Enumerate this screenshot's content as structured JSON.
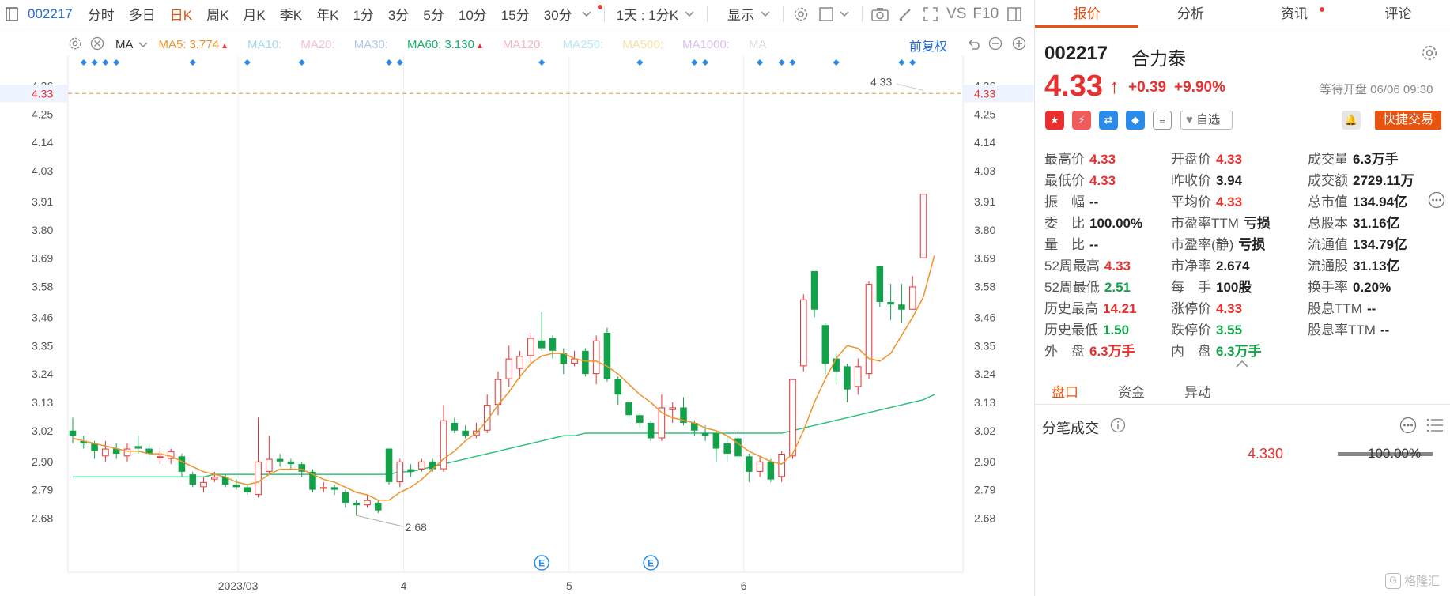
{
  "toolbar": {
    "code": "002217",
    "periods": [
      "分时",
      "多日",
      "日K",
      "周K",
      "月K",
      "季K",
      "年K",
      "1分",
      "3分",
      "5分",
      "10分",
      "15分",
      "30分"
    ],
    "active_period": "日K",
    "range": "1天 : 1分K",
    "display": "显示",
    "vs": "VS",
    "f10": "F10"
  },
  "ma_legend": {
    "type": "MA",
    "items": [
      {
        "label": "MA5:",
        "value": "3.774",
        "color": "#f0932b",
        "arrow": "▲"
      },
      {
        "label": "MA10:",
        "value": "",
        "color": "#a8d8f0"
      },
      {
        "label": "MA20:",
        "value": "",
        "color": "#f4c0d8"
      },
      {
        "label": "MA30:",
        "value": "",
        "color": "#b0c8f0"
      },
      {
        "label": "MA60:",
        "value": "3.130",
        "color": "#17b36b",
        "arrow": "▲"
      },
      {
        "label": "MA120:",
        "value": "",
        "color": "#f5b8c0"
      },
      {
        "label": "MA250:",
        "value": "",
        "color": "#b8e8f4"
      },
      {
        "label": "MA500:",
        "value": "",
        "color": "#f6e0a8"
      },
      {
        "label": "MA1000:",
        "value": "",
        "color": "#d8c0f0"
      },
      {
        "label": "MA",
        "value": "",
        "color": "#dddddd"
      }
    ],
    "fuquan": "前复权"
  },
  "chart_data": {
    "type": "candlestick",
    "y_ticks": [
      "4.36",
      "4.25",
      "4.14",
      "4.03",
      "3.91",
      "3.80",
      "3.69",
      "3.58",
      "3.46",
      "3.35",
      "3.24",
      "3.13",
      "3.02",
      "2.90",
      "2.79",
      "2.68"
    ],
    "ylim": [
      2.58,
      4.38
    ],
    "x_labels": [
      "2023/03",
      "4",
      "5",
      "6"
    ],
    "x_label_positions": [
      19,
      37.5,
      56,
      75.5
    ],
    "current_price_label": "4.33",
    "low_annotation": "2.68",
    "high_annotation": "4.33",
    "event_marker": "E",
    "event_indices": [
      43,
      53
    ],
    "candles": [
      {
        "o": 3.02,
        "c": 3.0,
        "h": 3.07,
        "l": 2.97
      },
      {
        "o": 2.98,
        "c": 2.97,
        "h": 3.0,
        "l": 2.95
      },
      {
        "o": 2.97,
        "c": 2.94,
        "h": 2.98,
        "l": 2.91
      },
      {
        "o": 2.92,
        "c": 2.95,
        "h": 2.98,
        "l": 2.9
      },
      {
        "o": 2.95,
        "c": 2.93,
        "h": 2.97,
        "l": 2.91
      },
      {
        "o": 2.92,
        "c": 2.95,
        "h": 2.97,
        "l": 2.9
      },
      {
        "o": 2.96,
        "c": 2.95,
        "h": 3.0,
        "l": 2.93
      },
      {
        "o": 2.95,
        "c": 2.93,
        "h": 2.97,
        "l": 2.9
      },
      {
        "o": 2.92,
        "c": 2.92,
        "h": 2.95,
        "l": 2.89
      },
      {
        "o": 2.91,
        "c": 2.94,
        "h": 2.95,
        "l": 2.89
      },
      {
        "o": 2.92,
        "c": 2.86,
        "h": 2.93,
        "l": 2.84
      },
      {
        "o": 2.85,
        "c": 2.81,
        "h": 2.86,
        "l": 2.8
      },
      {
        "o": 2.8,
        "c": 2.82,
        "h": 2.84,
        "l": 2.78
      },
      {
        "o": 2.83,
        "c": 2.84,
        "h": 2.86,
        "l": 2.82
      },
      {
        "o": 2.84,
        "c": 2.81,
        "h": 2.85,
        "l": 2.8
      },
      {
        "o": 2.81,
        "c": 2.8,
        "h": 2.83,
        "l": 2.79
      },
      {
        "o": 2.8,
        "c": 2.78,
        "h": 2.81,
        "l": 2.77
      },
      {
        "o": 2.77,
        "c": 2.9,
        "h": 3.07,
        "l": 2.76
      },
      {
        "o": 2.86,
        "c": 2.91,
        "h": 3.0,
        "l": 2.85
      },
      {
        "o": 2.91,
        "c": 2.9,
        "h": 2.93,
        "l": 2.88
      },
      {
        "o": 2.9,
        "c": 2.89,
        "h": 2.91,
        "l": 2.87
      },
      {
        "o": 2.89,
        "c": 2.86,
        "h": 2.9,
        "l": 2.84
      },
      {
        "o": 2.86,
        "c": 2.79,
        "h": 2.87,
        "l": 2.78
      },
      {
        "o": 2.8,
        "c": 2.8,
        "h": 2.82,
        "l": 2.78
      },
      {
        "o": 2.8,
        "c": 2.79,
        "h": 2.81,
        "l": 2.77
      },
      {
        "o": 2.78,
        "c": 2.74,
        "h": 2.79,
        "l": 2.72
      },
      {
        "o": 2.74,
        "c": 2.73,
        "h": 2.75,
        "l": 2.69
      },
      {
        "o": 2.73,
        "c": 2.75,
        "h": 2.77,
        "l": 2.72
      },
      {
        "o": 2.74,
        "c": 2.71,
        "h": 2.75,
        "l": 2.7
      },
      {
        "o": 2.95,
        "c": 2.82,
        "h": 2.95,
        "l": 2.81
      },
      {
        "o": 2.82,
        "c": 2.9,
        "h": 2.91,
        "l": 2.8
      },
      {
        "o": 2.87,
        "c": 2.86,
        "h": 2.89,
        "l": 2.84
      },
      {
        "o": 2.87,
        "c": 2.9,
        "h": 2.91,
        "l": 2.86
      },
      {
        "o": 2.9,
        "c": 2.87,
        "h": 2.91,
        "l": 2.86
      },
      {
        "o": 2.87,
        "c": 3.06,
        "h": 3.12,
        "l": 2.86
      },
      {
        "o": 3.05,
        "c": 3.02,
        "h": 3.07,
        "l": 3.01
      },
      {
        "o": 3.02,
        "c": 3.0,
        "h": 3.04,
        "l": 2.99
      },
      {
        "o": 3.0,
        "c": 3.02,
        "h": 3.05,
        "l": 2.99
      },
      {
        "o": 3.02,
        "c": 3.12,
        "h": 3.16,
        "l": 3.01
      },
      {
        "o": 3.12,
        "c": 3.22,
        "h": 3.25,
        "l": 3.08
      },
      {
        "o": 3.22,
        "c": 3.3,
        "h": 3.35,
        "l": 3.19
      },
      {
        "o": 3.26,
        "c": 3.31,
        "h": 3.33,
        "l": 3.22
      },
      {
        "o": 3.31,
        "c": 3.38,
        "h": 3.4,
        "l": 3.28
      },
      {
        "o": 3.37,
        "c": 3.34,
        "h": 3.48,
        "l": 3.33
      },
      {
        "o": 3.38,
        "c": 3.33,
        "h": 3.39,
        "l": 3.3
      },
      {
        "o": 3.32,
        "c": 3.28,
        "h": 3.34,
        "l": 3.24
      },
      {
        "o": 3.28,
        "c": 3.3,
        "h": 3.33,
        "l": 3.27
      },
      {
        "o": 3.33,
        "c": 3.24,
        "h": 3.34,
        "l": 3.23
      },
      {
        "o": 3.24,
        "c": 3.37,
        "h": 3.39,
        "l": 3.2
      },
      {
        "o": 3.4,
        "c": 3.22,
        "h": 3.42,
        "l": 3.21
      },
      {
        "o": 3.22,
        "c": 3.16,
        "h": 3.23,
        "l": 3.12
      },
      {
        "o": 3.13,
        "c": 3.08,
        "h": 3.14,
        "l": 3.06
      },
      {
        "o": 3.08,
        "c": 3.05,
        "h": 3.09,
        "l": 3.03
      },
      {
        "o": 3.05,
        "c": 2.99,
        "h": 3.06,
        "l": 2.98
      },
      {
        "o": 2.99,
        "c": 3.11,
        "h": 3.16,
        "l": 2.98
      },
      {
        "o": 3.1,
        "c": 3.11,
        "h": 3.13,
        "l": 3.05
      },
      {
        "o": 3.11,
        "c": 3.05,
        "h": 3.15,
        "l": 3.04
      },
      {
        "o": 3.05,
        "c": 3.02,
        "h": 3.06,
        "l": 3.0
      },
      {
        "o": 3.01,
        "c": 3.0,
        "h": 3.04,
        "l": 2.98
      },
      {
        "o": 3.01,
        "c": 2.95,
        "h": 3.02,
        "l": 2.9
      },
      {
        "o": 2.97,
        "c": 2.93,
        "h": 3.0,
        "l": 2.9
      },
      {
        "o": 2.99,
        "c": 2.92,
        "h": 3.0,
        "l": 2.91
      },
      {
        "o": 2.92,
        "c": 2.86,
        "h": 2.93,
        "l": 2.82
      },
      {
        "o": 2.86,
        "c": 2.9,
        "h": 2.92,
        "l": 2.84
      },
      {
        "o": 2.9,
        "c": 2.83,
        "h": 2.91,
        "l": 2.82
      },
      {
        "o": 2.84,
        "c": 2.93,
        "h": 2.94,
        "l": 2.82
      },
      {
        "o": 2.92,
        "c": 3.22,
        "h": 3.22,
        "l": 2.91
      },
      {
        "o": 3.27,
        "c": 3.53,
        "h": 3.55,
        "l": 3.25
      },
      {
        "o": 3.64,
        "c": 3.49,
        "h": 3.64,
        "l": 3.46
      },
      {
        "o": 3.43,
        "c": 3.28,
        "h": 3.44,
        "l": 3.24
      },
      {
        "o": 3.3,
        "c": 3.25,
        "h": 3.32,
        "l": 3.2
      },
      {
        "o": 3.27,
        "c": 3.18,
        "h": 3.28,
        "l": 3.13
      },
      {
        "o": 3.19,
        "c": 3.27,
        "h": 3.3,
        "l": 3.16
      },
      {
        "o": 3.24,
        "c": 3.59,
        "h": 3.6,
        "l": 3.22
      },
      {
        "o": 3.66,
        "c": 3.52,
        "h": 3.66,
        "l": 3.5
      },
      {
        "o": 3.52,
        "c": 3.51,
        "h": 3.59,
        "l": 3.45
      },
      {
        "o": 3.51,
        "c": 3.49,
        "h": 3.59,
        "l": 3.44
      },
      {
        "o": 3.49,
        "c": 3.58,
        "h": 3.62,
        "l": 3.49
      },
      {
        "o": 3.69,
        "c": 3.94,
        "h": 3.94,
        "l": 3.69
      }
    ],
    "ma5": [
      2.99,
      2.98,
      2.97,
      2.96,
      2.95,
      2.94,
      2.94,
      2.93,
      2.93,
      2.92,
      2.9,
      2.88,
      2.86,
      2.85,
      2.84,
      2.82,
      2.81,
      2.82,
      2.85,
      2.87,
      2.87,
      2.87,
      2.85,
      2.83,
      2.82,
      2.8,
      2.78,
      2.77,
      2.75,
      2.75,
      2.78,
      2.8,
      2.83,
      2.87,
      2.91,
      2.94,
      2.98,
      3.01,
      3.06,
      3.12,
      3.17,
      3.23,
      3.28,
      3.31,
      3.32,
      3.32,
      3.3,
      3.29,
      3.29,
      3.27,
      3.24,
      3.2,
      3.16,
      3.13,
      3.09,
      3.07,
      3.06,
      3.05,
      3.03,
      3.02,
      3.0,
      2.97,
      2.94,
      2.92,
      2.9,
      2.89,
      2.93,
      3.02,
      3.13,
      3.22,
      3.3,
      3.35,
      3.34,
      3.3,
      3.29,
      3.32,
      3.39,
      3.46,
      3.54,
      3.7
    ],
    "ma60": [
      2.84,
      2.84,
      2.84,
      2.84,
      2.84,
      2.84,
      2.84,
      2.84,
      2.84,
      2.84,
      2.84,
      2.84,
      2.84,
      2.85,
      2.85,
      2.85,
      2.85,
      2.85,
      2.85,
      2.85,
      2.85,
      2.85,
      2.85,
      2.85,
      2.85,
      2.85,
      2.85,
      2.85,
      2.85,
      2.85,
      2.86,
      2.86,
      2.87,
      2.88,
      2.89,
      2.9,
      2.91,
      2.92,
      2.93,
      2.94,
      2.95,
      2.96,
      2.97,
      2.98,
      2.99,
      3.0,
      3.0,
      3.01,
      3.01,
      3.01,
      3.01,
      3.01,
      3.01,
      3.01,
      3.01,
      3.01,
      3.01,
      3.01,
      3.01,
      3.01,
      3.01,
      3.01,
      3.01,
      3.01,
      3.01,
      3.01,
      3.02,
      3.03,
      3.04,
      3.05,
      3.06,
      3.07,
      3.08,
      3.09,
      3.1,
      3.11,
      3.12,
      3.13,
      3.14,
      3.16
    ]
  },
  "panel": {
    "tabs": [
      "报价",
      "分析",
      "资讯",
      "评论"
    ],
    "active_tab": "报价",
    "code": "002217",
    "name": "合力泰",
    "price": "4.33",
    "arrow": "↑",
    "change": "+0.39",
    "change_pct": "+9.90%",
    "status": "等待开盘 06/06 09:30",
    "watch": "自选",
    "trade": "快捷交易",
    "stats_col1": [
      {
        "label": "最高价",
        "value": "4.33",
        "color": "red"
      },
      {
        "label": "最低价",
        "value": "4.33",
        "color": "red"
      },
      {
        "label": "振　幅",
        "value": "--",
        "color": "dark"
      },
      {
        "label": "委　比",
        "value": "100.00%",
        "color": "dark"
      },
      {
        "label": "量　比",
        "value": "--",
        "color": "dark"
      },
      {
        "label": "52周最高",
        "value": "4.33",
        "color": "red"
      },
      {
        "label": "52周最低",
        "value": "2.51",
        "color": "green"
      },
      {
        "label": "历史最高",
        "value": "14.21",
        "color": "red"
      },
      {
        "label": "历史最低",
        "value": "1.50",
        "color": "green"
      },
      {
        "label": "外　盘",
        "value": "6.3万手",
        "color": "red"
      }
    ],
    "stats_col2": [
      {
        "label": "开盘价",
        "value": "4.33",
        "color": "red"
      },
      {
        "label": "昨收价",
        "value": "3.94",
        "color": "dark"
      },
      {
        "label": "平均价",
        "value": "4.33",
        "color": "red"
      },
      {
        "label": "市盈率TTM",
        "value": "亏损",
        "color": "dark"
      },
      {
        "label": "市盈率(静)",
        "value": "亏损",
        "color": "dark"
      },
      {
        "label": "市净率",
        "value": "2.674",
        "color": "dark"
      },
      {
        "label": "每　手",
        "value": "100股",
        "color": "dark"
      },
      {
        "label": "涨停价",
        "value": "4.33",
        "color": "red"
      },
      {
        "label": "跌停价",
        "value": "3.55",
        "color": "green"
      },
      {
        "label": "内　盘",
        "value": "6.3万手",
        "color": "green"
      }
    ],
    "stats_col3": [
      {
        "label": "成交量",
        "value": "6.3万手",
        "color": "dark"
      },
      {
        "label": "成交额",
        "value": "2729.11万",
        "color": "dark"
      },
      {
        "label": "总市值",
        "value": "134.94亿",
        "color": "dark"
      },
      {
        "label": "总股本",
        "value": "31.16亿",
        "color": "dark"
      },
      {
        "label": "流通值",
        "value": "134.79亿",
        "color": "dark"
      },
      {
        "label": "流通股",
        "value": "31.13亿",
        "color": "dark"
      },
      {
        "label": "换手率",
        "value": "0.20%",
        "color": "dark"
      },
      {
        "label": "股息TTM",
        "value": "--",
        "color": "dark"
      },
      {
        "label": "股息率TTM",
        "value": "--",
        "color": "dark"
      }
    ],
    "subtabs": [
      "盘口",
      "资金",
      "异动"
    ],
    "active_subtab": "盘口",
    "tick_title": "分笔成交",
    "tick_price": "4.330",
    "tick_pct": "100.00%",
    "tick_bar_fraction": 1.0,
    "watermark": "格隆汇"
  },
  "colors": {
    "up": "#e8312f",
    "down": "#12a34a",
    "accent": "#e8540f",
    "link": "#2a6bd6",
    "ma5": "#f0932b",
    "ma60": "#2ec27e"
  }
}
